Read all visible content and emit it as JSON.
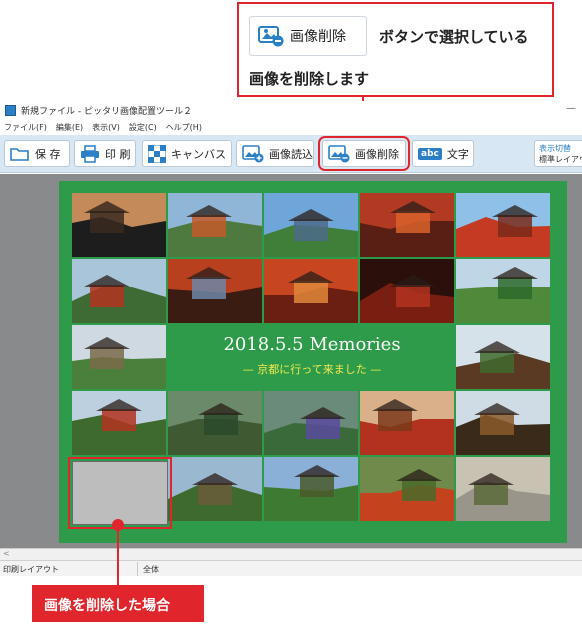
{
  "callout_top": {
    "button_label": "画像削除",
    "line1": "ボタンで選択している",
    "line2": "画像を削除します"
  },
  "app": {
    "title": "新規ファイル - ピッタリ画像配置ツール２",
    "minimize_glyph": "—",
    "menu": [
      "ファイル(F)",
      "編集(E)",
      "表示(V)",
      "設定(C)",
      "ヘルプ(H)"
    ],
    "toolbar": {
      "save": "保 存",
      "print": "印 刷",
      "canvas": "キャンバス",
      "load_image": "画像読込",
      "delete_image": "画像削除",
      "text": "文字",
      "view_switch_line1": "表示切替",
      "view_switch_line2": "標準レイアウト"
    },
    "icons": {
      "save": "folder-icon",
      "print": "printer-icon",
      "canvas": "checker-icon",
      "load_image": "image-add-icon",
      "delete_image": "image-remove-icon",
      "text": "text-abc-icon"
    },
    "text_icon_glyph": "abc",
    "canvas": {
      "title": "2018.5.5 Memories",
      "subtitle": "— 京都に行って来ました —"
    },
    "scroll_arrow": "<",
    "status": {
      "left": "印刷レイアウト",
      "right": "全体"
    }
  },
  "callout_bottom": {
    "label": "画像を削除した場合"
  },
  "colors": {
    "accent_red": "#e0262c",
    "page_green": "#2e9b4a",
    "toolbar_bg": "#d7e8f4",
    "subtitle_yellow": "#f2e84e"
  }
}
